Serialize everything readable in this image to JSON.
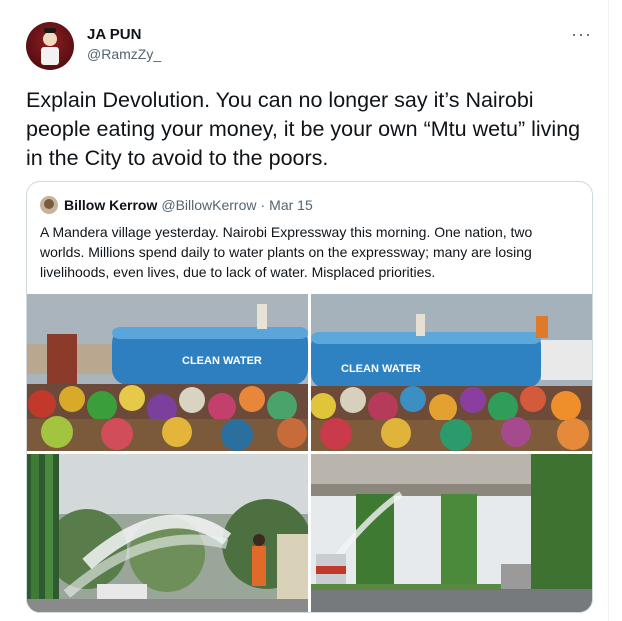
{
  "author": {
    "name": "JA PUN",
    "handle": "@RamzZy_"
  },
  "menu": {
    "more_label": "···"
  },
  "tweet": {
    "text": "Explain Devolution. You can no longer say it’s Nairobi people eating your money, it be your own “Mtu wetu” living in the City to avoid to the poors."
  },
  "quote": {
    "name": "Billow Kerrow",
    "handle": "@BillowKerrow",
    "sep": "·",
    "date": "Mar 15",
    "text": "A Mandera village yesterday. Nairobi Expressway this morning. One nation, two worlds. Millions spend daily to water plants on the expressway; many are losing livelihoods, even lives, due to lack of water. Misplaced priorities.",
    "images": [
      {
        "tank_label": "CLEAN  WATER"
      },
      {
        "tank_label": "CLEAN  WATER"
      },
      {},
      {}
    ]
  }
}
